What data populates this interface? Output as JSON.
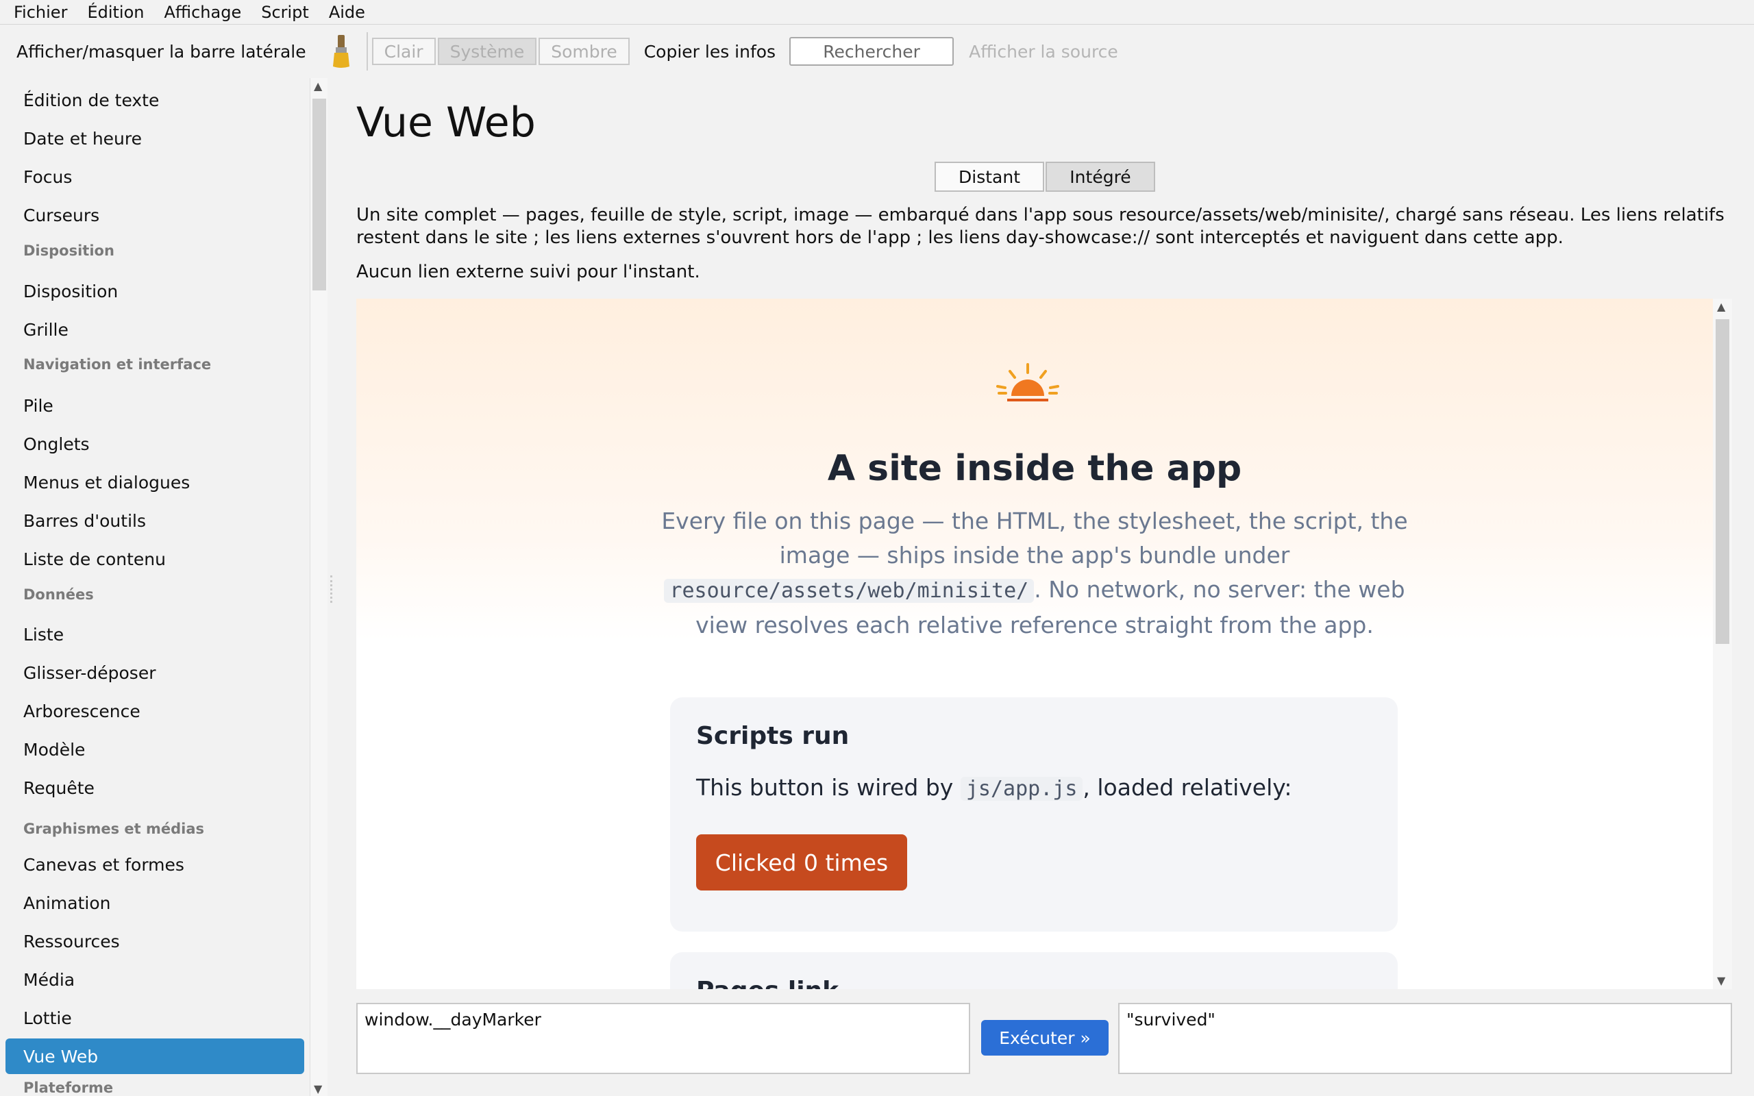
{
  "menubar": {
    "items": [
      "Fichier",
      "Édition",
      "Affichage",
      "Script",
      "Aide"
    ]
  },
  "toolbar": {
    "sidebar_toggle": "Afficher/masquer la barre latérale",
    "theme_options": [
      "Clair",
      "Système",
      "Sombre"
    ],
    "theme_selected": "Système",
    "copy_info": "Copier les infos",
    "search_label": "Rechercher",
    "view_source": "Afficher la source"
  },
  "sidebar": {
    "items": [
      {
        "type": "item",
        "label": "Édition de texte"
      },
      {
        "type": "item",
        "label": "Date et heure"
      },
      {
        "type": "item",
        "label": "Focus"
      },
      {
        "type": "item",
        "label": "Curseurs"
      },
      {
        "type": "header",
        "label": "Disposition"
      },
      {
        "type": "item",
        "label": "Disposition"
      },
      {
        "type": "item",
        "label": "Grille"
      },
      {
        "type": "header",
        "label": "Navigation et interface"
      },
      {
        "type": "item",
        "label": "Pile"
      },
      {
        "type": "item",
        "label": "Onglets"
      },
      {
        "type": "item",
        "label": "Menus et dialogues"
      },
      {
        "type": "item",
        "label": "Barres d'outils"
      },
      {
        "type": "item",
        "label": "Liste de contenu"
      },
      {
        "type": "header",
        "label": "Données"
      },
      {
        "type": "item",
        "label": "Liste"
      },
      {
        "type": "item",
        "label": "Glisser-déposer"
      },
      {
        "type": "item",
        "label": "Arborescence"
      },
      {
        "type": "item",
        "label": "Modèle"
      },
      {
        "type": "item",
        "label": "Requête"
      },
      {
        "type": "header",
        "label": "Graphismes et médias"
      },
      {
        "type": "item",
        "label": "Canevas et formes"
      },
      {
        "type": "item",
        "label": "Animation"
      },
      {
        "type": "item",
        "label": "Ressources"
      },
      {
        "type": "item",
        "label": "Média"
      },
      {
        "type": "item",
        "label": "Lottie"
      },
      {
        "type": "item",
        "label": "Vue Web",
        "active": true
      },
      {
        "type": "header",
        "label": "Plateforme"
      }
    ]
  },
  "main": {
    "title": "Vue Web",
    "modes": [
      "Distant",
      "Intégré"
    ],
    "mode_selected": "Intégré",
    "description": "Un site complet — pages, feuille de style, script, image — embarqué dans l'app sous resource/assets/web/minisite/, chargé sans réseau. Les liens relatifs restent dans le site ; les liens externes s'ouvrent hors de l'app ; les liens day-showcase:// sont interceptés et naviguent dans cette app.",
    "external_status": "Aucun lien externe suivi pour l'instant."
  },
  "webview": {
    "hero_title": "A site inside the app",
    "hero_sub_1": "Every file on this page — the HTML, the stylesheet, the script, the image — ships inside the app's bundle under",
    "hero_code": "resource/assets/web/minisite/",
    "hero_sub_2": ". No network, no server: the web view resolves each relative reference straight from the app.",
    "card_title": "Scripts run",
    "card_text_1": "This button is wired by",
    "card_code": "js/app.js",
    "card_text_2": ", loaded relatively:",
    "card_button": "Clicked 0 times",
    "card2_title": "Pages link"
  },
  "console": {
    "input": "window.__dayMarker",
    "run_label": "Exécuter »",
    "output": "\"survived\""
  },
  "colors": {
    "accent": "#2f8ac8",
    "run_button": "#2b6fd6",
    "web_button": "#c64a1e",
    "sun": "#f0a020"
  }
}
